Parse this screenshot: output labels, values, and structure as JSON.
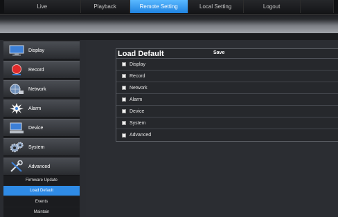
{
  "nav": {
    "tabs": [
      {
        "label": "Live",
        "active": false
      },
      {
        "label": "Playback",
        "active": false
      },
      {
        "label": "Remote Setting",
        "active": true
      },
      {
        "label": "Local Setting",
        "active": false
      },
      {
        "label": "Logout",
        "active": false
      }
    ]
  },
  "sidebar": {
    "items": [
      {
        "label": "Display",
        "icon": "monitor-icon"
      },
      {
        "label": "Record",
        "icon": "record-icon"
      },
      {
        "label": "Network",
        "icon": "network-icon"
      },
      {
        "label": "Alarm",
        "icon": "alarm-icon"
      },
      {
        "label": "Device",
        "icon": "device-icon"
      },
      {
        "label": "System",
        "icon": "gears-icon"
      },
      {
        "label": "Advanced",
        "icon": "tools-icon"
      }
    ],
    "subitems": [
      {
        "label": "Firmware Update",
        "active": false
      },
      {
        "label": "Load Default",
        "active": true
      },
      {
        "label": "Events",
        "active": false
      },
      {
        "label": "Maintain",
        "active": false
      }
    ]
  },
  "panel": {
    "title": "Load Default",
    "save_label": "Save",
    "options": [
      "Display",
      "Record",
      "Network",
      "Alarm",
      "Device",
      "System",
      "Advanced"
    ]
  },
  "colors": {
    "accent": "#2f8be6",
    "tab_active": "#3fa0f5"
  }
}
